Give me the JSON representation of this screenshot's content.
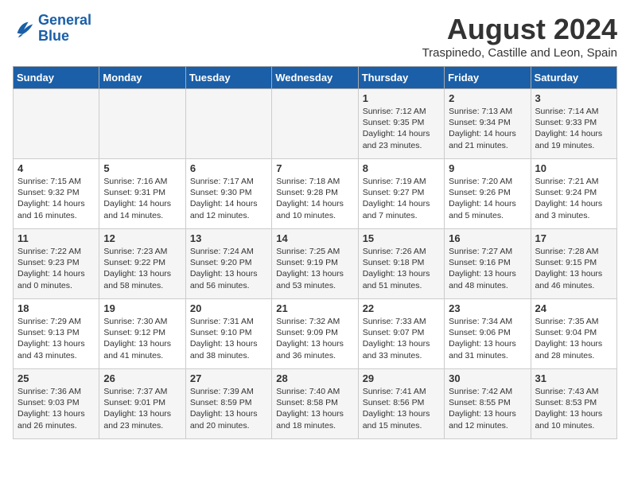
{
  "logo": {
    "line1": "General",
    "line2": "Blue"
  },
  "title": "August 2024",
  "subtitle": "Traspinedo, Castille and Leon, Spain",
  "days_of_week": [
    "Sunday",
    "Monday",
    "Tuesday",
    "Wednesday",
    "Thursday",
    "Friday",
    "Saturday"
  ],
  "weeks": [
    [
      {
        "day": "",
        "info": ""
      },
      {
        "day": "",
        "info": ""
      },
      {
        "day": "",
        "info": ""
      },
      {
        "day": "",
        "info": ""
      },
      {
        "day": "1",
        "info": "Sunrise: 7:12 AM\nSunset: 9:35 PM\nDaylight: 14 hours and 23 minutes."
      },
      {
        "day": "2",
        "info": "Sunrise: 7:13 AM\nSunset: 9:34 PM\nDaylight: 14 hours and 21 minutes."
      },
      {
        "day": "3",
        "info": "Sunrise: 7:14 AM\nSunset: 9:33 PM\nDaylight: 14 hours and 19 minutes."
      }
    ],
    [
      {
        "day": "4",
        "info": "Sunrise: 7:15 AM\nSunset: 9:32 PM\nDaylight: 14 hours and 16 minutes."
      },
      {
        "day": "5",
        "info": "Sunrise: 7:16 AM\nSunset: 9:31 PM\nDaylight: 14 hours and 14 minutes."
      },
      {
        "day": "6",
        "info": "Sunrise: 7:17 AM\nSunset: 9:30 PM\nDaylight: 14 hours and 12 minutes."
      },
      {
        "day": "7",
        "info": "Sunrise: 7:18 AM\nSunset: 9:28 PM\nDaylight: 14 hours and 10 minutes."
      },
      {
        "day": "8",
        "info": "Sunrise: 7:19 AM\nSunset: 9:27 PM\nDaylight: 14 hours and 7 minutes."
      },
      {
        "day": "9",
        "info": "Sunrise: 7:20 AM\nSunset: 9:26 PM\nDaylight: 14 hours and 5 minutes."
      },
      {
        "day": "10",
        "info": "Sunrise: 7:21 AM\nSunset: 9:24 PM\nDaylight: 14 hours and 3 minutes."
      }
    ],
    [
      {
        "day": "11",
        "info": "Sunrise: 7:22 AM\nSunset: 9:23 PM\nDaylight: 14 hours and 0 minutes."
      },
      {
        "day": "12",
        "info": "Sunrise: 7:23 AM\nSunset: 9:22 PM\nDaylight: 13 hours and 58 minutes."
      },
      {
        "day": "13",
        "info": "Sunrise: 7:24 AM\nSunset: 9:20 PM\nDaylight: 13 hours and 56 minutes."
      },
      {
        "day": "14",
        "info": "Sunrise: 7:25 AM\nSunset: 9:19 PM\nDaylight: 13 hours and 53 minutes."
      },
      {
        "day": "15",
        "info": "Sunrise: 7:26 AM\nSunset: 9:18 PM\nDaylight: 13 hours and 51 minutes."
      },
      {
        "day": "16",
        "info": "Sunrise: 7:27 AM\nSunset: 9:16 PM\nDaylight: 13 hours and 48 minutes."
      },
      {
        "day": "17",
        "info": "Sunrise: 7:28 AM\nSunset: 9:15 PM\nDaylight: 13 hours and 46 minutes."
      }
    ],
    [
      {
        "day": "18",
        "info": "Sunrise: 7:29 AM\nSunset: 9:13 PM\nDaylight: 13 hours and 43 minutes."
      },
      {
        "day": "19",
        "info": "Sunrise: 7:30 AM\nSunset: 9:12 PM\nDaylight: 13 hours and 41 minutes."
      },
      {
        "day": "20",
        "info": "Sunrise: 7:31 AM\nSunset: 9:10 PM\nDaylight: 13 hours and 38 minutes."
      },
      {
        "day": "21",
        "info": "Sunrise: 7:32 AM\nSunset: 9:09 PM\nDaylight: 13 hours and 36 minutes."
      },
      {
        "day": "22",
        "info": "Sunrise: 7:33 AM\nSunset: 9:07 PM\nDaylight: 13 hours and 33 minutes."
      },
      {
        "day": "23",
        "info": "Sunrise: 7:34 AM\nSunset: 9:06 PM\nDaylight: 13 hours and 31 minutes."
      },
      {
        "day": "24",
        "info": "Sunrise: 7:35 AM\nSunset: 9:04 PM\nDaylight: 13 hours and 28 minutes."
      }
    ],
    [
      {
        "day": "25",
        "info": "Sunrise: 7:36 AM\nSunset: 9:03 PM\nDaylight: 13 hours and 26 minutes."
      },
      {
        "day": "26",
        "info": "Sunrise: 7:37 AM\nSunset: 9:01 PM\nDaylight: 13 hours and 23 minutes."
      },
      {
        "day": "27",
        "info": "Sunrise: 7:39 AM\nSunset: 8:59 PM\nDaylight: 13 hours and 20 minutes."
      },
      {
        "day": "28",
        "info": "Sunrise: 7:40 AM\nSunset: 8:58 PM\nDaylight: 13 hours and 18 minutes."
      },
      {
        "day": "29",
        "info": "Sunrise: 7:41 AM\nSunset: 8:56 PM\nDaylight: 13 hours and 15 minutes."
      },
      {
        "day": "30",
        "info": "Sunrise: 7:42 AM\nSunset: 8:55 PM\nDaylight: 13 hours and 12 minutes."
      },
      {
        "day": "31",
        "info": "Sunrise: 7:43 AM\nSunset: 8:53 PM\nDaylight: 13 hours and 10 minutes."
      }
    ]
  ]
}
